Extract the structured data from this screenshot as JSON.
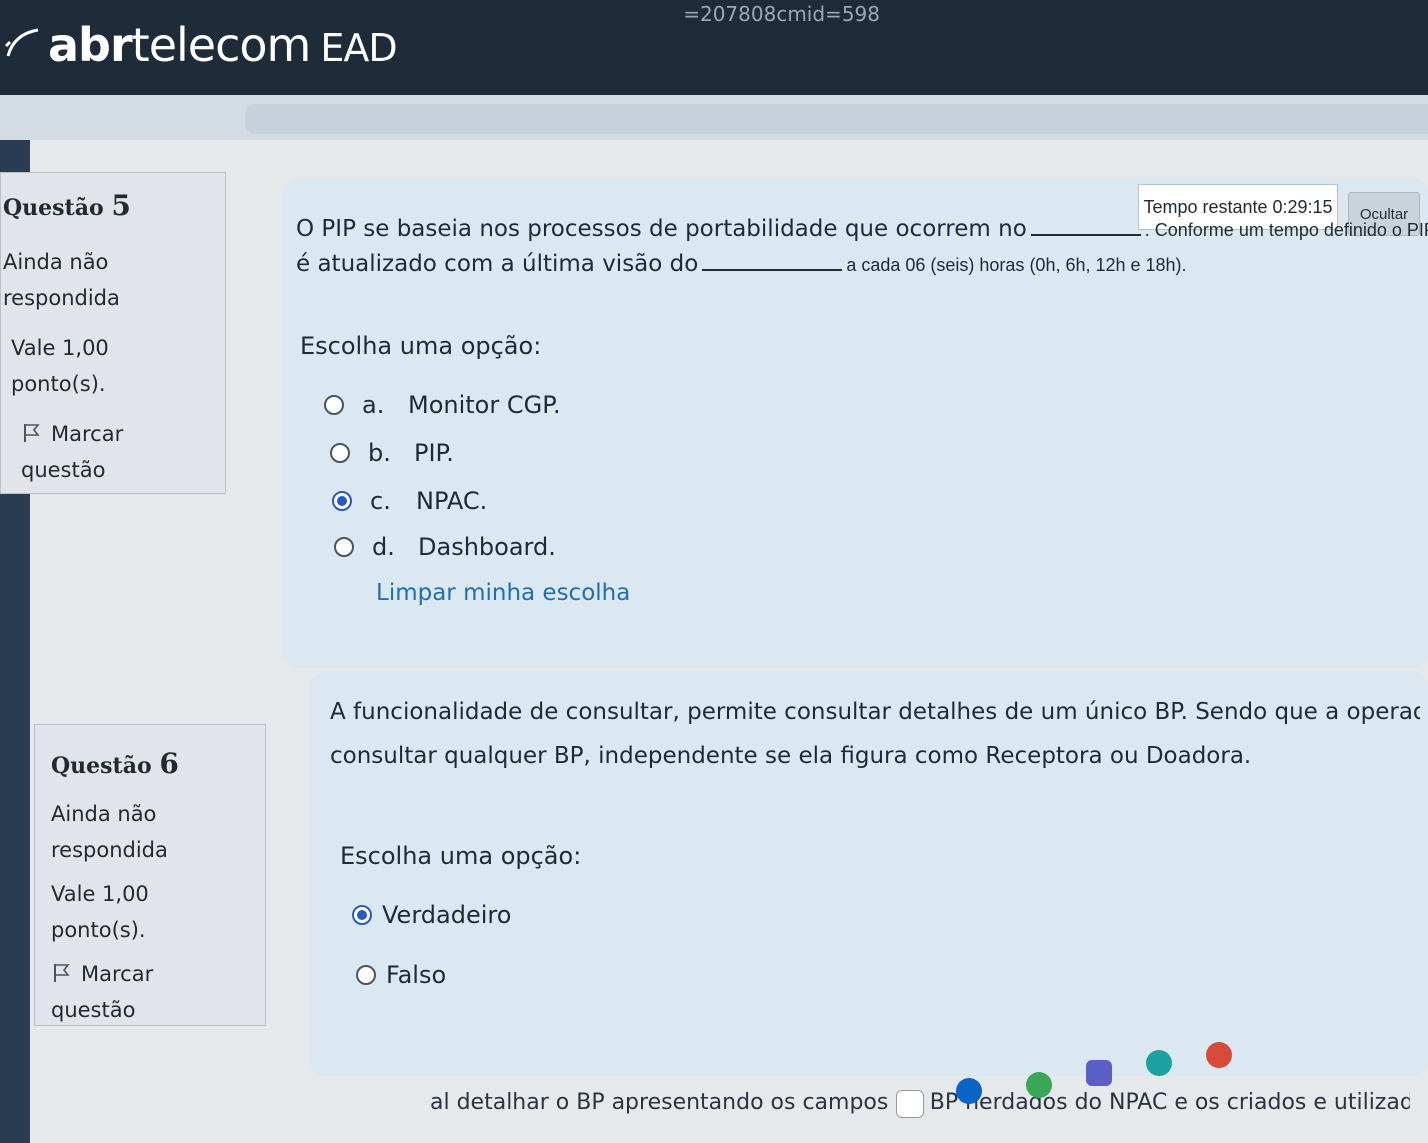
{
  "browser": {
    "url_fragment": "=207808cmid=598"
  },
  "header": {
    "logo_bold": "abr",
    "logo_light": "telecom",
    "logo_suffix": "EAD"
  },
  "timer": {
    "label": "Tempo restante 0:29:15",
    "hide_label": "Ocultar"
  },
  "questions": [
    {
      "label": "Questão",
      "number": "5",
      "state": "Ainda não respondida",
      "grade": "Vale 1,00 ponto(s).",
      "flag": "Marcar questão",
      "text_part1": "O PIP se baseia nos processos de portabilidade que ocorrem no",
      "text_part2": ". Conforme um tempo definido o PIP",
      "text_part3": "é atualizado com a última visão do",
      "text_part4": "a cada 06 (seis) horas (0h, 6h, 12h e 18h).",
      "prompt": "Escolha uma opção:",
      "options": [
        {
          "letter": "a.",
          "text": "Monitor CGP.",
          "selected": false
        },
        {
          "letter": "b.",
          "text": "PIP.",
          "selected": false
        },
        {
          "letter": "c.",
          "text": "NPAC.",
          "selected": true
        },
        {
          "letter": "d.",
          "text": "Dashboard.",
          "selected": false
        }
      ],
      "clear_choice": "Limpar minha escolha"
    },
    {
      "label": "Questão",
      "number": "6",
      "state": "Ainda não respondida",
      "grade": "Vale 1,00 ponto(s).",
      "flag": "Marcar questão",
      "text_line1": "A funcionalidade de consultar, permite consultar detalhes de um único BP. Sendo que a operadora poderá",
      "text_line1_b": "consultar qualquer BP, independente se ela figura como Receptora ou Doadora.",
      "prompt": "Escolha uma opção:",
      "options": [
        {
          "text": "Verdadeiro",
          "selected": true
        },
        {
          "text": "Falso",
          "selected": false
        }
      ]
    }
  ],
  "next_question_preview": "al detalhar o BP apresentando os campos do BP herdados do NPAC e os criados e utilizados para cálculo",
  "colors": {
    "accent": "#2b59c3",
    "link": "#1f6fb0",
    "header_bg": "#1e2b38",
    "content_bg": "#dce8f1"
  }
}
